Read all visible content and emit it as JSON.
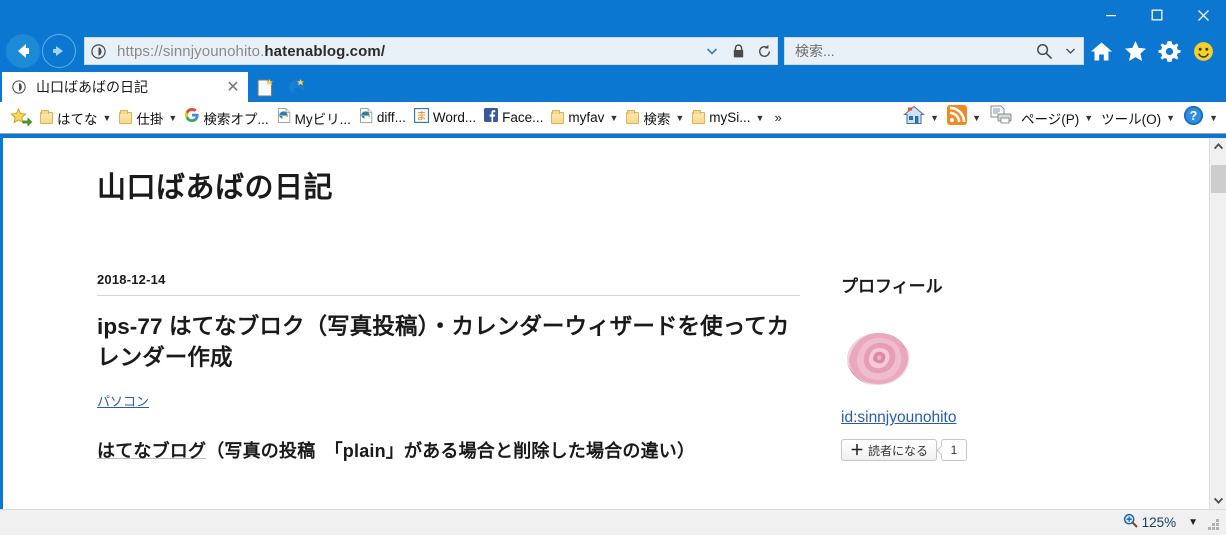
{
  "window": {
    "minimize_label": "—",
    "maximize_label": "□",
    "close_label": "✕"
  },
  "navigation": {
    "back_icon": "back-arrow-icon",
    "forward_icon": "forward-arrow-icon",
    "address": {
      "url_prefix": "https://sinnjyounohito.",
      "url_domain": "hatenablog.com/",
      "site_icon": "info-icon",
      "dropdown_icon": "chevron-down-icon",
      "lock_icon": "lock-icon",
      "refresh_icon": "refresh-icon"
    },
    "search": {
      "placeholder": "検索...",
      "search_icon": "search-icon",
      "dropdown_icon": "chevron-down-icon"
    },
    "toolbar_icons": [
      "home-icon",
      "favorites-star-icon",
      "settings-gear-icon",
      "smiley-feedback-icon"
    ]
  },
  "tabs": {
    "active": {
      "favicon": "info-icon",
      "title": "山口ばあばの日記",
      "close_label": "✕"
    },
    "new_tab_icon": "new-tab-icon",
    "edge_icon": "open-in-edge-icon"
  },
  "favorites_bar": {
    "add_favorite_icon": "add-to-favorites-icon",
    "items": [
      {
        "label": "はてな",
        "icon": "folder-icon",
        "has_caret": true
      },
      {
        "label": "仕掛",
        "icon": "folder-icon",
        "has_caret": true
      },
      {
        "label": "検索オプ...",
        "icon": "google-icon",
        "has_caret": false
      },
      {
        "label": "Myビリ...",
        "icon": "ie-page-icon",
        "has_caret": false
      },
      {
        "label": "diff...",
        "icon": "ie-page-icon",
        "has_caret": false
      },
      {
        "label": "Word...",
        "icon": "ma-kanji-icon",
        "has_caret": false
      },
      {
        "label": "Face...",
        "icon": "facebook-icon",
        "has_caret": false
      },
      {
        "label": "myfav",
        "icon": "folder-icon",
        "has_caret": true
      },
      {
        "label": "検索",
        "icon": "folder-icon",
        "has_caret": true
      },
      {
        "label": "mySi...",
        "icon": "folder-icon",
        "has_caret": true
      }
    ],
    "overflow_label": "»"
  },
  "command_bar": {
    "items": [
      {
        "label": "",
        "icon": "home-house-icon",
        "has_caret": true
      },
      {
        "label": "",
        "icon": "rss-feed-icon",
        "has_caret": true
      },
      {
        "label": "",
        "icon": "print-icon",
        "has_caret": false
      },
      {
        "label": "ページ(P)",
        "icon": "",
        "has_caret": true
      },
      {
        "label": "ツール(O)",
        "icon": "",
        "has_caret": true
      },
      {
        "label": "",
        "icon": "help-question-icon",
        "has_caret": true
      }
    ]
  },
  "page": {
    "blog_title": "山口ばあばの日記",
    "entry": {
      "date": "2018-12-14",
      "title": "ips-77 はてなブロク（写真投稿）・カレンダーウィザードを使ってカレンダー作成",
      "category": "パソコン",
      "body_underlined": "はてなブログ",
      "body_rest": "（写真の投稿　「plain」がある場合と削除した場合の違い）"
    },
    "sidebar": {
      "heading": "プロフィール",
      "avatar_icon": "rose-avatar-icon",
      "user_id": "id:sinnjyounohito",
      "subscribe_button": "読者になる",
      "subscribe_plus": "＋",
      "subscriber_count": "1"
    }
  },
  "status_bar": {
    "zoom_icon": "zoom-magnifier-icon",
    "zoom_level": "125%",
    "zoom_caret": "▼"
  },
  "scrollbar": {
    "up_arrow": "∧",
    "down_arrow": "∨"
  },
  "colors": {
    "chrome_blue": "#0b77d0",
    "link_blue": "#2b5aa8",
    "address_bg": "#e9f1f8"
  }
}
